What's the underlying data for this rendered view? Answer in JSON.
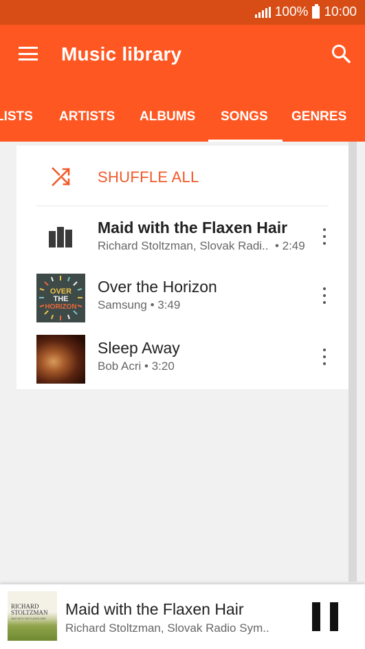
{
  "status_bar": {
    "battery": "100%",
    "time": "10:00"
  },
  "app_bar": {
    "title": "Music library"
  },
  "tabs": [
    {
      "label": "LISTS"
    },
    {
      "label": "ARTISTS"
    },
    {
      "label": "ALBUMS"
    },
    {
      "label": "SONGS",
      "active": true
    },
    {
      "label": "GENRES"
    }
  ],
  "shuffle": {
    "label": "SHUFFLE ALL"
  },
  "songs": [
    {
      "title": "Maid with the Flaxen Hair",
      "artist": "Richard Stoltzman, Slovak Radi..",
      "duration": "• 2:49",
      "playing": true
    },
    {
      "title": "Over the Horizon",
      "artist": "Samsung",
      "duration": "• 3:49",
      "art": {
        "line1": "OVER",
        "line2": "THE",
        "line3": "HORIZON"
      }
    },
    {
      "title": "Sleep Away",
      "artist": "Bob Acri",
      "duration": "• 3:20"
    }
  ],
  "mini_player": {
    "title": "Maid with the Flaxen Hair",
    "artist": "Richard Stoltzman, Slovak Radio Sym..",
    "art": {
      "line1": "RICHARD",
      "line2": "STOLTZMAN",
      "line3": "MAID WITH THE FLAXEN HAIR"
    }
  },
  "colors": {
    "status_bar": "#d84d16",
    "app_bar": "#ff5722",
    "accent": "#ef5a2a"
  },
  "icons": {
    "menu": "menu-icon",
    "search": "search-icon",
    "shuffle": "shuffle-icon",
    "now_playing": "equalizer-icon",
    "more": "more-vert-icon",
    "pause": "pause-icon"
  }
}
